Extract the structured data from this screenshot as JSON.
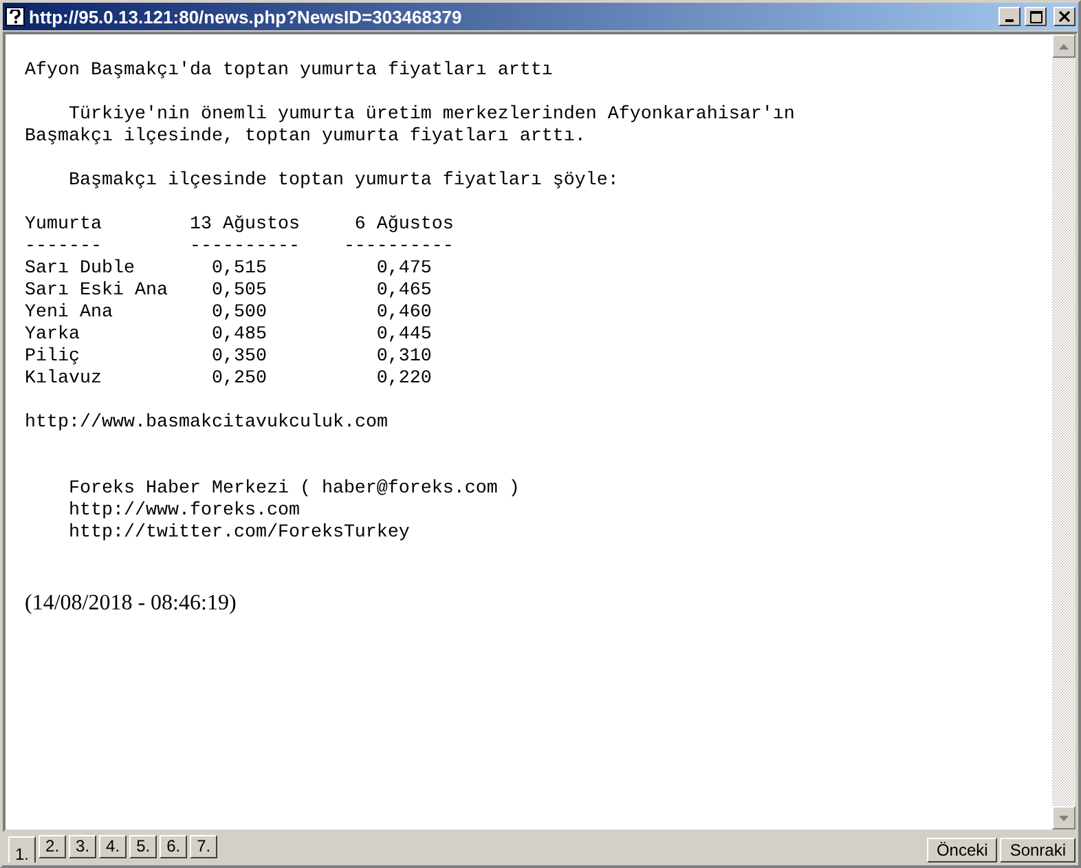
{
  "window": {
    "title": "http://95.0.13.121:80/news.php?NewsID=303468379"
  },
  "article": {
    "headline": "Afyon Başmakçı'da toptan yumurta fiyatları arttı",
    "paragraphs": [
      "Türkiye'nin önemli yumurta üretim merkezlerinden Afyonkarahisar'ın",
      "Başmakçı ilçesinde, toptan yumurta fiyatları arttı."
    ],
    "intro": "Başmakçı ilçesinde toptan yumurta fiyatları şöyle:",
    "table": {
      "columns": [
        "Yumurta",
        "13 Ağustos",
        "6 Ağustos"
      ],
      "separators": [
        "-------",
        "----------",
        "----------"
      ],
      "rows": [
        [
          "Sarı Duble",
          "0,515",
          "0,475"
        ],
        [
          "Sarı Eski Ana",
          "0,505",
          "0,465"
        ],
        [
          "Yeni Ana",
          "0,500",
          "0,460"
        ],
        [
          "Yarka",
          "0,485",
          "0,445"
        ],
        [
          "Piliç",
          "0,350",
          "0,310"
        ],
        [
          "Kılavuz",
          "0,250",
          "0,220"
        ]
      ]
    },
    "source_link": "http://www.basmakcitavukculuk.com",
    "footer": [
      "Foreks Haber Merkezi ( haber@foreks.com )",
      "http://www.foreks.com",
      "http://twitter.com/ForeksTurkey"
    ],
    "timestamp": "(14/08/2018 - 08:46:19)"
  },
  "pages": [
    {
      "label": "1.",
      "selected": true
    },
    {
      "label": "2.",
      "selected": false
    },
    {
      "label": "3.",
      "selected": false
    },
    {
      "label": "4.",
      "selected": false
    },
    {
      "label": "5.",
      "selected": false
    },
    {
      "label": "6.",
      "selected": false
    },
    {
      "label": "7.",
      "selected": false
    }
  ],
  "buttons": [
    "Önceki",
    "Sonraki"
  ]
}
